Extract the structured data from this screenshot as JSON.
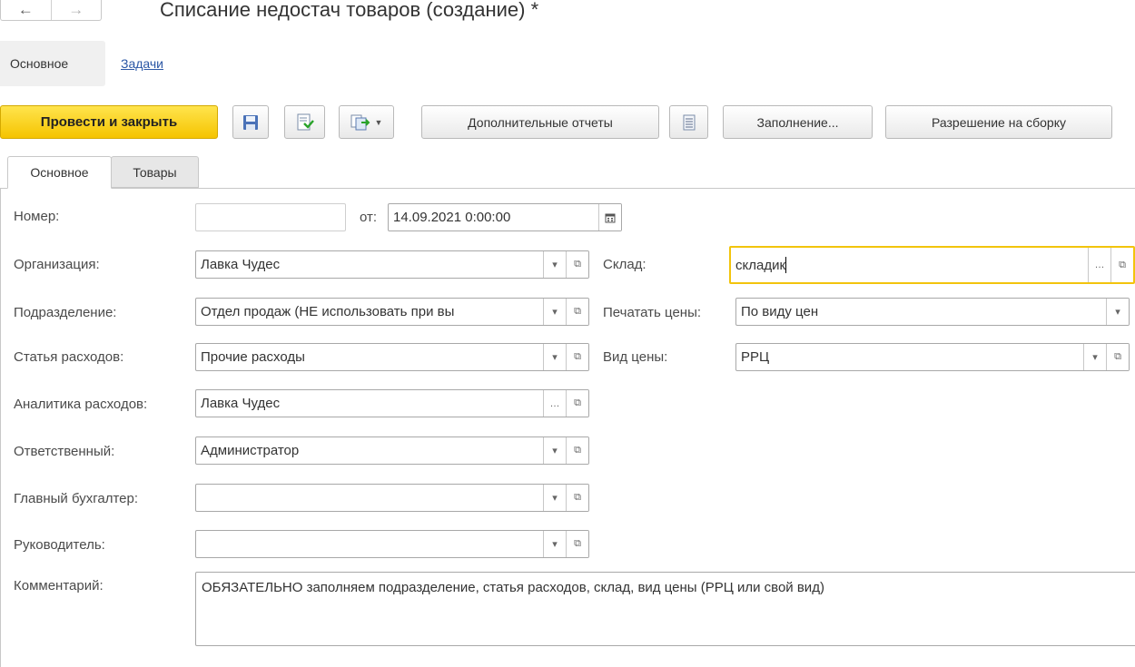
{
  "header": {
    "back_icon": "arrow-left-icon",
    "forward_icon": "arrow-right-icon",
    "title": "Списание недостач товаров (создание) *"
  },
  "sections": {
    "main": "Основное",
    "tasks": "Задачи"
  },
  "toolbar": {
    "post_close": "Провести и закрыть",
    "save_icon": "floppy-disk-icon",
    "post_icon": "document-post-icon",
    "create_based_icon": "create-based-on-icon",
    "extra_reports": "Дополнительные отчеты",
    "reports_list_icon": "document-list-icon",
    "fill": "Заполнение...",
    "assembly_permit": "Разрешение на сборку"
  },
  "tabs": [
    "Основное",
    "Товары"
  ],
  "form": {
    "number_label": "Номер:",
    "number_value": "",
    "date_label": "от:",
    "date_value": "14.09.2021  0:00:00",
    "organization_label": "Организация:",
    "organization_value": "Лавка Чудес",
    "department_label": "Подразделение:",
    "department_value": "Отдел продаж (НЕ использовать при вы",
    "expense_item_label": "Статья расходов:",
    "expense_item_value": "Прочие расходы",
    "expense_analytics_label": "Аналитика расходов:",
    "expense_analytics_value": "Лавка Чудес",
    "responsible_label": "Ответственный:",
    "responsible_value": "Администратор",
    "chief_accountant_label": "Главный бухгалтер:",
    "chief_accountant_value": "",
    "manager_label": "Руководитель:",
    "manager_value": "",
    "comment_label": "Комментарий:",
    "comment_value": "ОБЯЗАТЕЛЬНО заполняем подразделение, статья расходов, склад, вид цены (РРЦ или свой вид)",
    "warehouse_label": "Склад:",
    "warehouse_value": "складик",
    "print_prices_label": "Печатать цены:",
    "print_prices_value": "По виду цен",
    "price_type_label": "Вид цены:",
    "price_type_value": "РРЦ"
  },
  "colors": {
    "accent_yellow": "#f5c400",
    "link_blue": "#2b57a5",
    "focus_border": "#f2c40c"
  }
}
